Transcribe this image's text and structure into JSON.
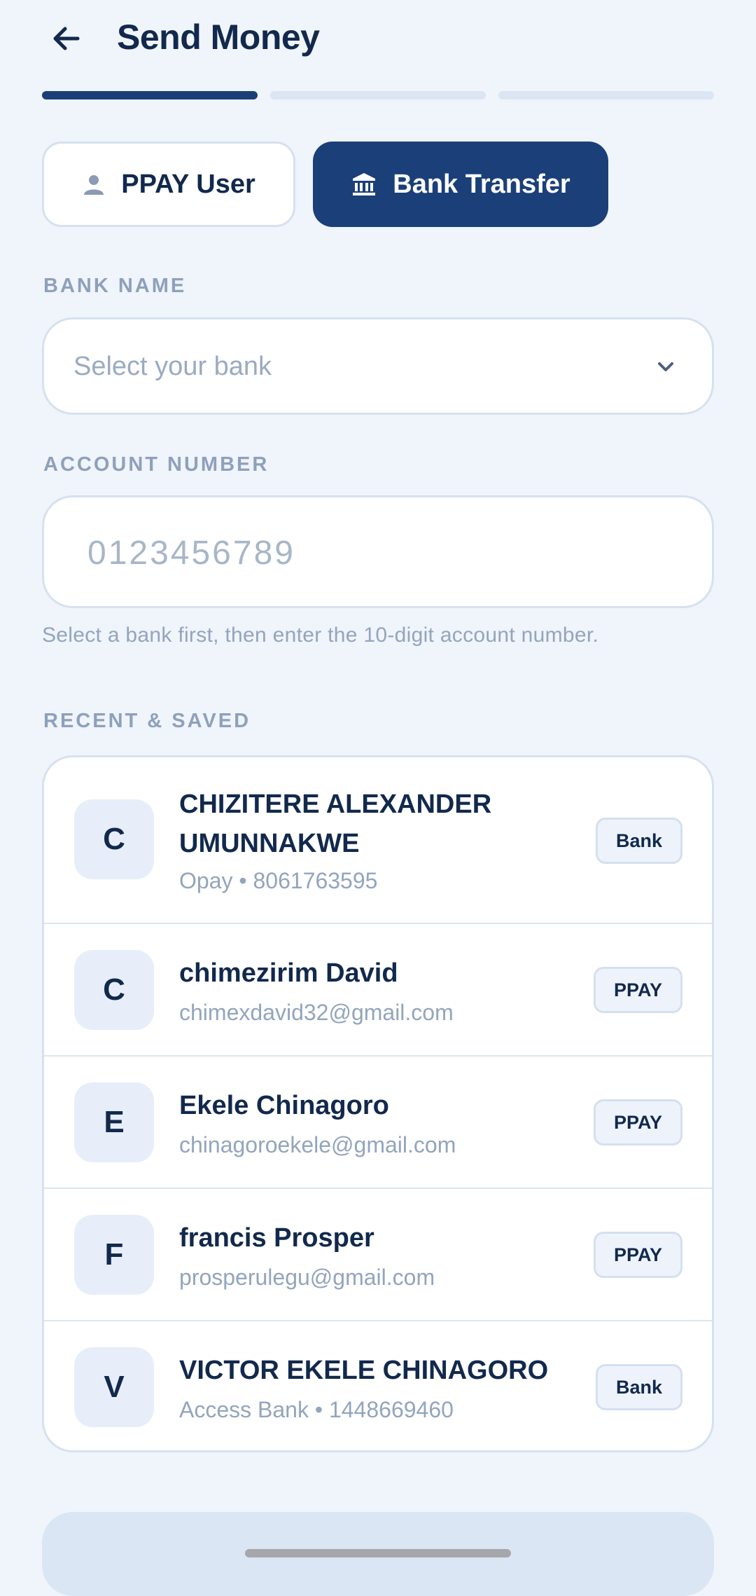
{
  "header": {
    "title": "Send Money",
    "back_icon": "arrow-left-icon"
  },
  "progress": {
    "total_steps": 3,
    "current_step": 1
  },
  "transfer_type": {
    "ppay_label": "PPAY User",
    "bank_label": "Bank Transfer",
    "selected": "bank"
  },
  "bank": {
    "label": "BANK NAME",
    "placeholder": "Select your bank"
  },
  "account": {
    "label": "ACCOUNT NUMBER",
    "placeholder": "0123456789",
    "helper": "Select a bank first, then enter the 10-digit account number."
  },
  "recent": {
    "label": "RECENT & SAVED",
    "items": [
      {
        "initial": "C",
        "name": "CHIZITERE ALEXANDER UMUNNAKWE",
        "sub": "Opay • 8061763595",
        "badge": "Bank"
      },
      {
        "initial": "C",
        "name": "chimezirim David",
        "sub": "chimexdavid32@gmail.com",
        "badge": "PPAY"
      },
      {
        "initial": "E",
        "name": "Ekele Chinagoro",
        "sub": "chinagoroekele@gmail.com",
        "badge": "PPAY"
      },
      {
        "initial": "F",
        "name": "francis Prosper",
        "sub": "prosperulegu@gmail.com",
        "badge": "PPAY"
      },
      {
        "initial": "V",
        "name": "VICTOR EKELE CHINAGORO",
        "sub": "Access Bank • 1448669460",
        "badge": "Bank"
      }
    ]
  },
  "colors": {
    "primary": "#1b3f78",
    "background": "#f0f4fb",
    "muted_text": "#93a5bd"
  }
}
